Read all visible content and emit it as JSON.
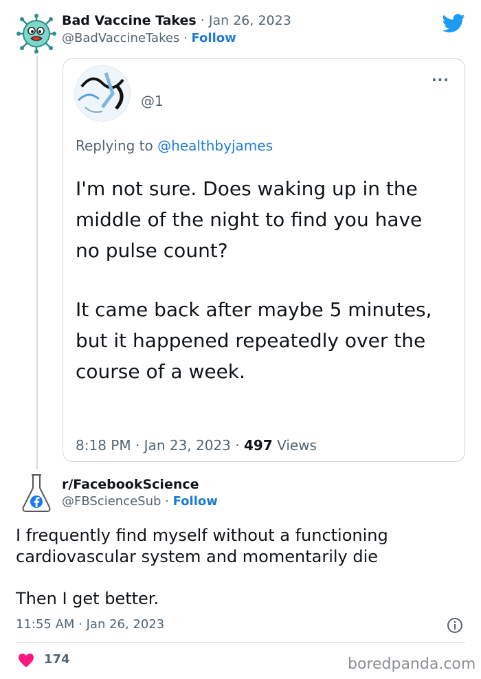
{
  "tweet": {
    "author_name": "Bad Vaccine Takes",
    "date_sep": " · ",
    "date": "Jan 26, 2023",
    "handle": "@BadVaccineTakes",
    "follow_sep": " · ",
    "follow_label": "Follow"
  },
  "quoted": {
    "handle_partial": "@1",
    "menu": "···",
    "replying_prefix": "Replying to ",
    "replying_to": "@healthbyjames",
    "paragraph1": "I'm not sure. Does waking up in the middle of the night to find you have no pulse count?",
    "paragraph2": "It came back after maybe 5 minutes, but it happened repeatedly over the course of a week.",
    "time": "8:18 PM · Jan 23, 2023 · ",
    "views_count": "497",
    "views_label": " Views"
  },
  "reply": {
    "author_name": "r/FacebookScience",
    "handle": "@FBScienceSub",
    "follow_sep": " · ",
    "follow_label": "Follow",
    "paragraph1": "I frequently find myself without a functioning cardiovascular system and momentarily die",
    "paragraph2": "Then I get better.",
    "timestamp": "11:55 AM · Jan 26, 2023",
    "likes": "174"
  },
  "watermark": "boredpanda.com",
  "icons": {
    "bird": "twitter-bird-icon",
    "heart": "heart-icon",
    "info": "info-icon"
  },
  "colors": {
    "link": "#1d7bd8",
    "twitter_blue": "#1d9bf0",
    "heart": "#f91880",
    "muted": "#536471"
  }
}
